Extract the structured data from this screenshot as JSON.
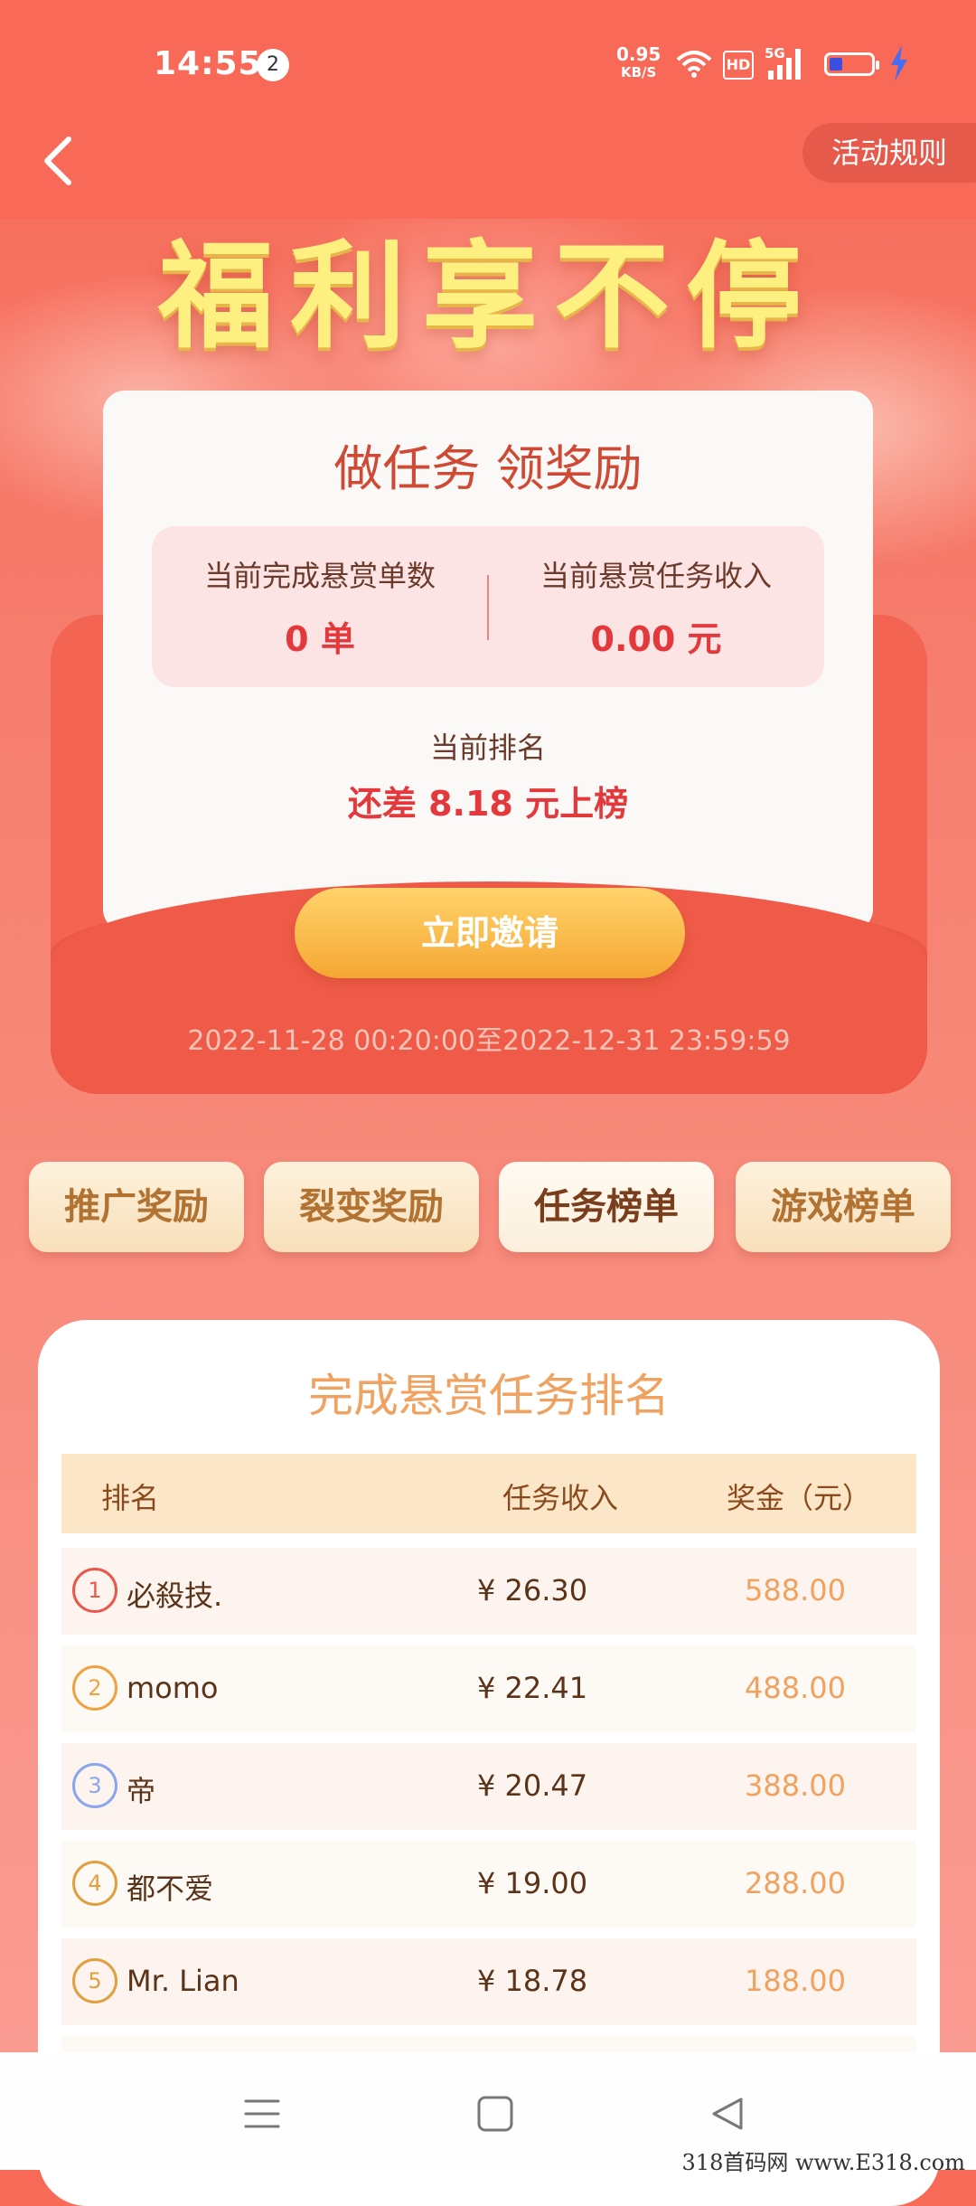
{
  "status_bar": {
    "time": "14:55",
    "notification_count": "2",
    "net_speed_value": "0.95",
    "net_speed_unit": "KB/S",
    "hd_label": "HD",
    "signal_label": "5G"
  },
  "header": {
    "rules_label": "活动规则"
  },
  "banner": {
    "title": "福利享不停"
  },
  "card": {
    "title": "做任务 领奖励",
    "stat_orders_label": "当前完成悬赏单数",
    "stat_orders_value": "0 单",
    "stat_income_label": "当前悬赏任务收入",
    "stat_income_value": "0.00 元",
    "rank_label": "当前排名",
    "rank_value": "还差 8.18 元上榜",
    "invite_label": "立即邀请",
    "period": "2022-11-28 00:20:00至2022-12-31 23:59:59"
  },
  "tabs": [
    {
      "label": "推广奖励"
    },
    {
      "label": "裂变奖励"
    },
    {
      "label": "任务榜单",
      "active": true
    },
    {
      "label": "游戏榜单"
    }
  ],
  "leaderboard": {
    "title": "完成悬赏任务排名",
    "headers": {
      "rank": "排名",
      "income": "任务收入",
      "bonus": "奖金（元）"
    },
    "rows": [
      {
        "rank": "1",
        "name": "必殺技.",
        "income": "¥ 26.30",
        "bonus": "588.00",
        "color": "#e8574a"
      },
      {
        "rank": "2",
        "name": "momo",
        "income": "¥ 22.41",
        "bonus": "488.00",
        "color": "#f0a240"
      },
      {
        "rank": "3",
        "name": "帝",
        "income": "¥ 20.47",
        "bonus": "388.00",
        "color": "#8aa6ea"
      },
      {
        "rank": "4",
        "name": "都不爱",
        "income": "¥ 19.00",
        "bonus": "288.00",
        "color": "#e0a040"
      },
      {
        "rank": "5",
        "name": "Mr. Lian",
        "income": "¥ 18.78",
        "bonus": "188.00",
        "color": "#e0a040"
      }
    ]
  },
  "watermark": "318首码网 www.E318.com",
  "colors": {
    "primary_red": "#f86a57",
    "accent_red": "#e4393c",
    "gold": "#f0a260",
    "button_gold": "#f6a733"
  }
}
